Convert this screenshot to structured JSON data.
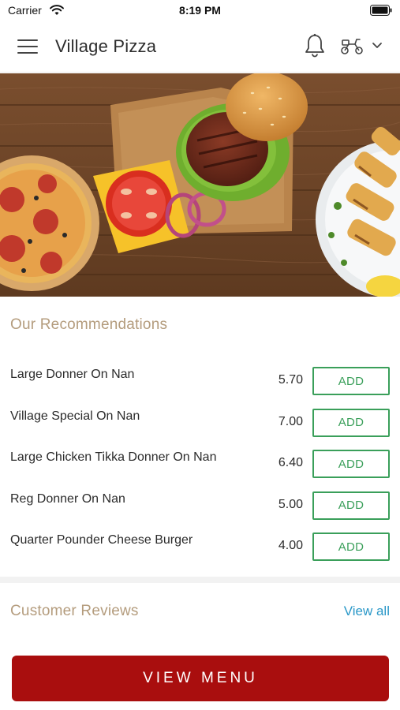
{
  "status_bar": {
    "carrier": "Carrier",
    "time": "8:19 PM"
  },
  "header": {
    "title": "Village Pizza",
    "icons": [
      "menu-icon",
      "bell-icon",
      "scooter-icon",
      "chevron-down-icon"
    ]
  },
  "hero": {
    "image": "food-banner"
  },
  "recommendations": {
    "title": "Our Recommendations",
    "items": [
      {
        "name": "Large Donner On Nan",
        "price": "5.70",
        "action": "ADD"
      },
      {
        "name": "Village Special On Nan",
        "price": "7.00",
        "action": "ADD"
      },
      {
        "name": "Large Chicken Tikka Donner On Nan",
        "price": "6.40",
        "action": "ADD"
      },
      {
        "name": "Reg Donner On Nan",
        "price": "5.00",
        "action": "ADD"
      },
      {
        "name": "Quarter Pounder Cheese Burger",
        "price": "4.00",
        "action": "ADD"
      }
    ]
  },
  "reviews": {
    "title": "Customer Reviews",
    "view_all": "View all"
  },
  "footer": {
    "view_menu": "VIEW MENU"
  },
  "colors": {
    "accent_tan": "#b49c7d",
    "add_green": "#3a9f5a",
    "link_blue": "#2a98c8",
    "menu_red": "#a90e0e"
  }
}
